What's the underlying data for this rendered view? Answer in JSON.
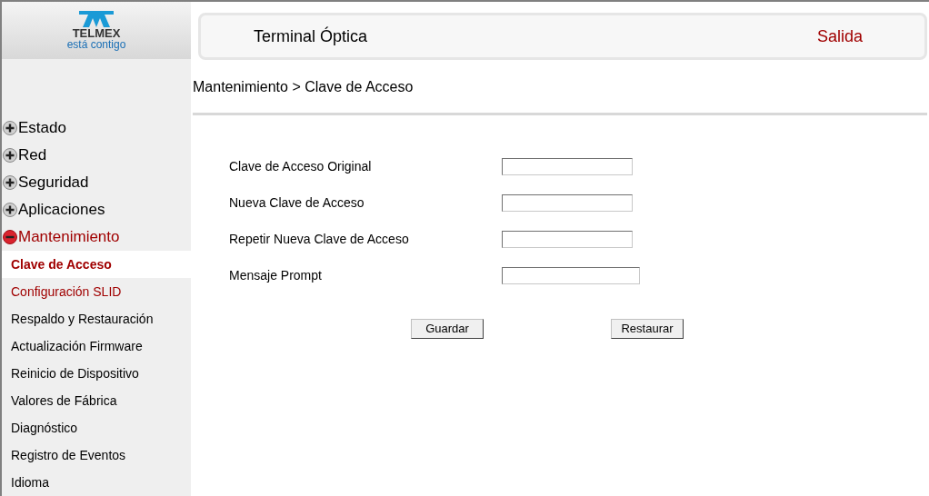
{
  "logo": {
    "brand": "TELMEX",
    "slogan": "está contigo"
  },
  "header": {
    "title": "Terminal Óptica",
    "logout": "Salida"
  },
  "sidebar": {
    "items": [
      {
        "label": "Estado",
        "expanded": false
      },
      {
        "label": "Red",
        "expanded": false
      },
      {
        "label": "Seguridad",
        "expanded": false
      },
      {
        "label": "Aplicaciones",
        "expanded": false
      },
      {
        "label": "Mantenimiento",
        "expanded": true,
        "children": [
          {
            "label": "Clave de Acceso",
            "selected": true
          },
          {
            "label": "Configuración SLID",
            "selected": false
          },
          {
            "label": "Respaldo y Restauración",
            "selected": false
          },
          {
            "label": "Actualización Firmware",
            "selected": false
          },
          {
            "label": "Reinicio de Dispositivo",
            "selected": false
          },
          {
            "label": "Valores de Fábrica",
            "selected": false
          },
          {
            "label": "Diagnóstico",
            "selected": false
          },
          {
            "label": "Registro de Eventos",
            "selected": false
          },
          {
            "label": "Idioma",
            "selected": false
          }
        ]
      }
    ]
  },
  "breadcrumb": "Mantenimiento > Clave de Acceso",
  "form": {
    "fields": [
      {
        "label": "Clave de Acceso Original"
      },
      {
        "label": "Nueva Clave de Acceso"
      },
      {
        "label": "Repetir Nueva Clave de Acceso"
      },
      {
        "label": "Mensaje Prompt"
      }
    ],
    "buttons": [
      "Guardar",
      "Restaurar"
    ]
  }
}
